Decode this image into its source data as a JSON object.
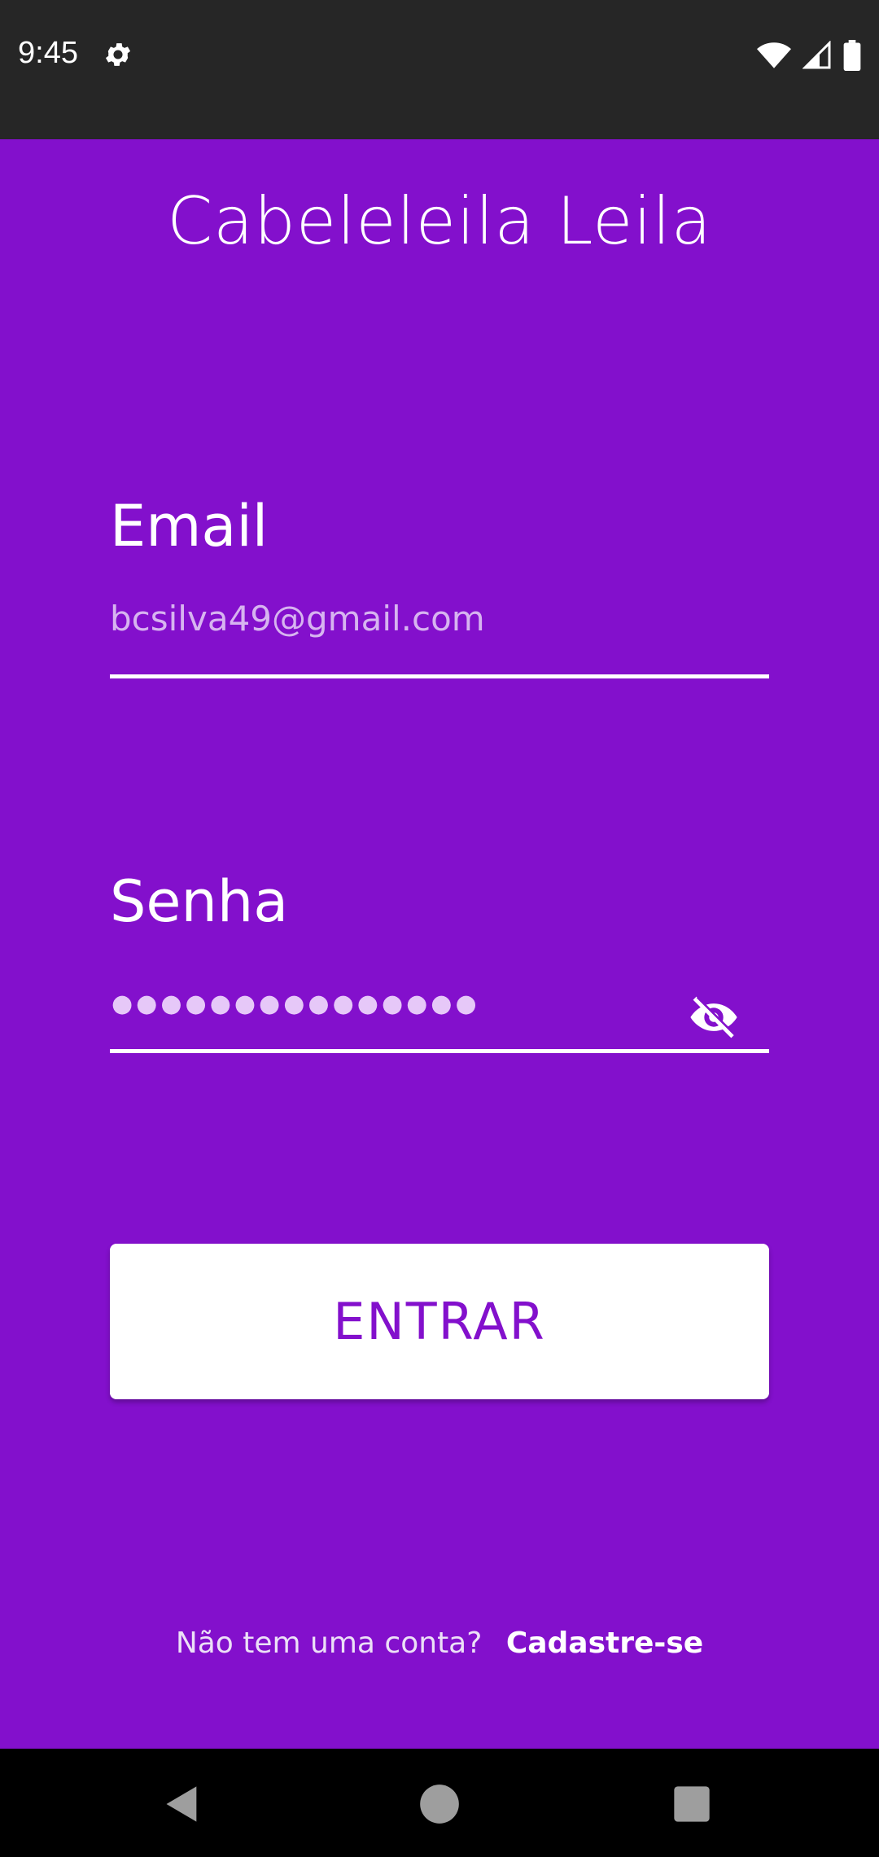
{
  "status_bar": {
    "time": "9:45",
    "icons": [
      "settings-icon",
      "wifi-icon",
      "signal-icon",
      "battery-icon"
    ]
  },
  "app": {
    "title": "Cabeleleila Leila"
  },
  "form": {
    "email": {
      "label": "Email",
      "value": "bcsilva49@gmail.com"
    },
    "password": {
      "label": "Senha",
      "masked_value": "●●●●●●●●●●●●●●●",
      "visibility_icon": "eye-off-icon"
    },
    "submit_label": "ENTRAR"
  },
  "signup": {
    "prompt": "Não tem uma conta?",
    "link": "Cadastre-se"
  },
  "nav_bar": {
    "buttons": [
      "back-icon",
      "home-icon",
      "recents-icon"
    ]
  },
  "colors": {
    "primary": "#8310cc",
    "status_bar": "#262626",
    "nav_bar": "#000000",
    "button_bg": "#ffffff"
  }
}
